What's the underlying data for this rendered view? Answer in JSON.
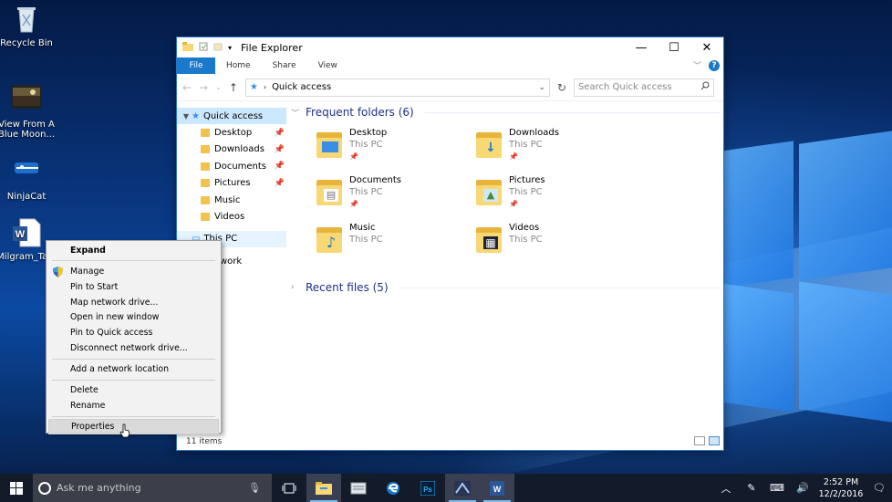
{
  "desktop": {
    "icons": [
      {
        "label": "Recycle Bin",
        "icon": "recycle-bin-icon"
      },
      {
        "label": "View From A Blue Moon...",
        "icon": "video-file-icon"
      },
      {
        "label": "NinjaCat",
        "icon": "ninjacat-icon"
      },
      {
        "label": "Milgram_Ta...",
        "icon": "word-document-icon"
      }
    ]
  },
  "window": {
    "title": "File Explorer",
    "ribbon_tabs": [
      "File",
      "Home",
      "Share",
      "View"
    ],
    "address": "Quick access",
    "search_placeholder": "Search Quick access",
    "nav": {
      "quick_access": "Quick access",
      "items": [
        "Desktop",
        "Downloads",
        "Documents",
        "Pictures",
        "Music",
        "Videos"
      ],
      "this_pc": "This PC",
      "network": "Network"
    },
    "frequent_header": "Frequent folders (6)",
    "folders": [
      {
        "name": "Desktop",
        "location": "This PC",
        "pinned": true,
        "badge": ""
      },
      {
        "name": "Downloads",
        "location": "This PC",
        "pinned": true,
        "badge": "↓"
      },
      {
        "name": "Documents",
        "location": "This PC",
        "pinned": true,
        "badge": "▤"
      },
      {
        "name": "Pictures",
        "location": "This PC",
        "pinned": true,
        "badge": "▲"
      },
      {
        "name": "Music",
        "location": "This PC",
        "pinned": false,
        "badge": "♪"
      },
      {
        "name": "Videos",
        "location": "This PC",
        "pinned": false,
        "badge": "▦"
      }
    ],
    "recent_header": "Recent files (5)",
    "status": "11 items"
  },
  "context_menu": {
    "items": [
      {
        "label": "Expand",
        "bold": true
      },
      "sep",
      {
        "label": "Manage",
        "shield": true
      },
      {
        "label": "Pin to Start"
      },
      {
        "label": "Map network drive..."
      },
      {
        "label": "Open in new window"
      },
      {
        "label": "Pin to Quick access"
      },
      {
        "label": "Disconnect network drive..."
      },
      "sep",
      {
        "label": "Add a network location"
      },
      "sep",
      {
        "label": "Delete"
      },
      {
        "label": "Rename"
      },
      "sep",
      {
        "label": "Properties",
        "hover": true
      }
    ]
  },
  "taskbar": {
    "search_placeholder": "Ask me anything",
    "time": "2:52 PM",
    "date": "12/2/2016"
  },
  "colors": {
    "accent": "#1979ca",
    "folder": "#f8d775",
    "taskbar": "#131a2a"
  }
}
